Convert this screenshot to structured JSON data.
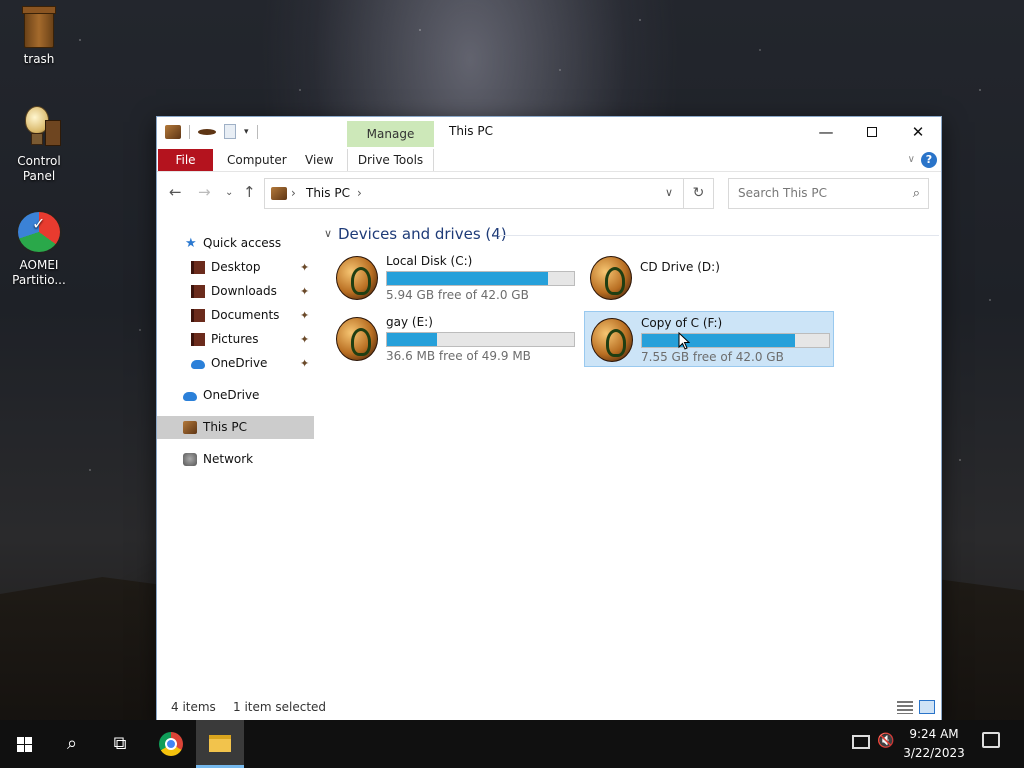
{
  "desktop": {
    "icons": [
      {
        "label": "trash"
      },
      {
        "label": "Control Panel"
      },
      {
        "label": "AOMEI Partitio..."
      }
    ]
  },
  "window": {
    "title": "This PC",
    "contextual_tab": "Manage",
    "ribbon_tabs": [
      "File",
      "Computer",
      "View",
      "Drive Tools"
    ],
    "help_label": "?"
  },
  "address_bar": {
    "location": "This PC"
  },
  "search": {
    "placeholder": "Search This PC"
  },
  "navigation": {
    "quick_access": "Quick access",
    "pinned": [
      "Desktop",
      "Downloads",
      "Documents",
      "Pictures",
      "OneDrive"
    ],
    "onedrive": "OneDrive",
    "this_pc": "This PC",
    "network": "Network"
  },
  "content": {
    "group_title": "Devices and drives (4)",
    "drives": [
      {
        "name": "Local Disk (C:)",
        "free": "5.94 GB free of 42.0 GB",
        "used_fraction": 0.86
      },
      {
        "name": "CD Drive (D:)",
        "free": "",
        "used_fraction": null
      },
      {
        "name": "gay (E:)",
        "free": "36.6 MB free of 49.9 MB",
        "used_fraction": 0.27
      },
      {
        "name": "Copy of C (F:)",
        "free": "7.55 GB free of 42.0 GB",
        "used_fraction": 0.82
      }
    ]
  },
  "status": {
    "items": "4 items",
    "selected": "1 item selected"
  },
  "taskbar": {
    "time": "9:24 AM",
    "date": "3/22/2023"
  },
  "colors": {
    "file_tab": "#b4131e",
    "manage_tab": "#cde8b9",
    "selection": "#cce4f7",
    "drive_bar": "#26a0da"
  }
}
